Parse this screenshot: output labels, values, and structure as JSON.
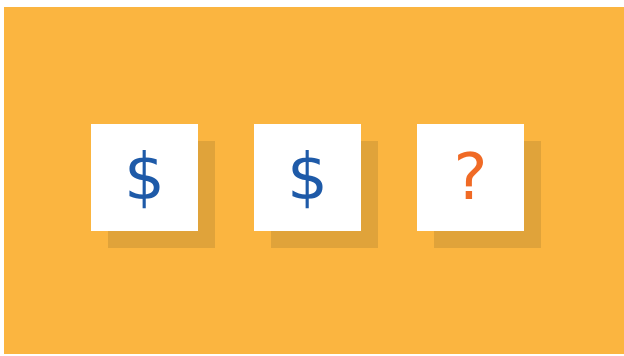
{
  "colors": {
    "background": "#fbb540",
    "tile_shadow": "#e0a33a",
    "tile": "#ffffff",
    "dollar": "#1e5aa8",
    "question": "#f06a25"
  },
  "tiles": [
    {
      "symbol": "$",
      "icon": "dollar-sign-icon",
      "color": "#1e5aa8"
    },
    {
      "symbol": "$",
      "icon": "dollar-sign-icon",
      "color": "#1e5aa8"
    },
    {
      "symbol": "?",
      "icon": "question-mark-icon",
      "color": "#f06a25"
    }
  ]
}
